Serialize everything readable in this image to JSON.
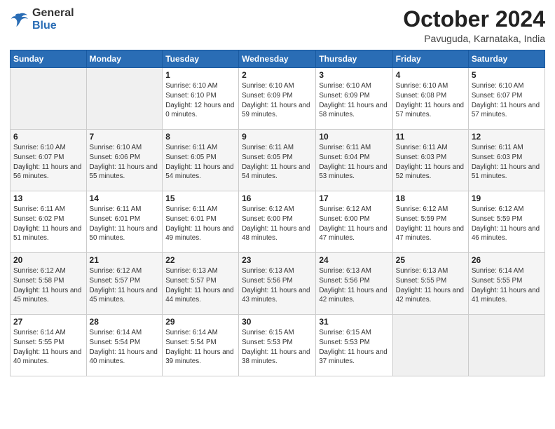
{
  "logo": {
    "line1": "General",
    "line2": "Blue"
  },
  "header": {
    "month": "October 2024",
    "location": "Pavuguda, Karnataka, India"
  },
  "weekdays": [
    "Sunday",
    "Monday",
    "Tuesday",
    "Wednesday",
    "Thursday",
    "Friday",
    "Saturday"
  ],
  "weeks": [
    [
      {
        "day": "",
        "info": ""
      },
      {
        "day": "",
        "info": ""
      },
      {
        "day": "1",
        "info": "Sunrise: 6:10 AM\nSunset: 6:10 PM\nDaylight: 12 hours\nand 0 minutes."
      },
      {
        "day": "2",
        "info": "Sunrise: 6:10 AM\nSunset: 6:09 PM\nDaylight: 11 hours\nand 59 minutes."
      },
      {
        "day": "3",
        "info": "Sunrise: 6:10 AM\nSunset: 6:09 PM\nDaylight: 11 hours\nand 58 minutes."
      },
      {
        "day": "4",
        "info": "Sunrise: 6:10 AM\nSunset: 6:08 PM\nDaylight: 11 hours\nand 57 minutes."
      },
      {
        "day": "5",
        "info": "Sunrise: 6:10 AM\nSunset: 6:07 PM\nDaylight: 11 hours\nand 57 minutes."
      }
    ],
    [
      {
        "day": "6",
        "info": "Sunrise: 6:10 AM\nSunset: 6:07 PM\nDaylight: 11 hours\nand 56 minutes."
      },
      {
        "day": "7",
        "info": "Sunrise: 6:10 AM\nSunset: 6:06 PM\nDaylight: 11 hours\nand 55 minutes."
      },
      {
        "day": "8",
        "info": "Sunrise: 6:11 AM\nSunset: 6:05 PM\nDaylight: 11 hours\nand 54 minutes."
      },
      {
        "day": "9",
        "info": "Sunrise: 6:11 AM\nSunset: 6:05 PM\nDaylight: 11 hours\nand 54 minutes."
      },
      {
        "day": "10",
        "info": "Sunrise: 6:11 AM\nSunset: 6:04 PM\nDaylight: 11 hours\nand 53 minutes."
      },
      {
        "day": "11",
        "info": "Sunrise: 6:11 AM\nSunset: 6:03 PM\nDaylight: 11 hours\nand 52 minutes."
      },
      {
        "day": "12",
        "info": "Sunrise: 6:11 AM\nSunset: 6:03 PM\nDaylight: 11 hours\nand 51 minutes."
      }
    ],
    [
      {
        "day": "13",
        "info": "Sunrise: 6:11 AM\nSunset: 6:02 PM\nDaylight: 11 hours\nand 51 minutes."
      },
      {
        "day": "14",
        "info": "Sunrise: 6:11 AM\nSunset: 6:01 PM\nDaylight: 11 hours\nand 50 minutes."
      },
      {
        "day": "15",
        "info": "Sunrise: 6:11 AM\nSunset: 6:01 PM\nDaylight: 11 hours\nand 49 minutes."
      },
      {
        "day": "16",
        "info": "Sunrise: 6:12 AM\nSunset: 6:00 PM\nDaylight: 11 hours\nand 48 minutes."
      },
      {
        "day": "17",
        "info": "Sunrise: 6:12 AM\nSunset: 6:00 PM\nDaylight: 11 hours\nand 47 minutes."
      },
      {
        "day": "18",
        "info": "Sunrise: 6:12 AM\nSunset: 5:59 PM\nDaylight: 11 hours\nand 47 minutes."
      },
      {
        "day": "19",
        "info": "Sunrise: 6:12 AM\nSunset: 5:59 PM\nDaylight: 11 hours\nand 46 minutes."
      }
    ],
    [
      {
        "day": "20",
        "info": "Sunrise: 6:12 AM\nSunset: 5:58 PM\nDaylight: 11 hours\nand 45 minutes."
      },
      {
        "day": "21",
        "info": "Sunrise: 6:12 AM\nSunset: 5:57 PM\nDaylight: 11 hours\nand 45 minutes."
      },
      {
        "day": "22",
        "info": "Sunrise: 6:13 AM\nSunset: 5:57 PM\nDaylight: 11 hours\nand 44 minutes."
      },
      {
        "day": "23",
        "info": "Sunrise: 6:13 AM\nSunset: 5:56 PM\nDaylight: 11 hours\nand 43 minutes."
      },
      {
        "day": "24",
        "info": "Sunrise: 6:13 AM\nSunset: 5:56 PM\nDaylight: 11 hours\nand 42 minutes."
      },
      {
        "day": "25",
        "info": "Sunrise: 6:13 AM\nSunset: 5:55 PM\nDaylight: 11 hours\nand 42 minutes."
      },
      {
        "day": "26",
        "info": "Sunrise: 6:14 AM\nSunset: 5:55 PM\nDaylight: 11 hours\nand 41 minutes."
      }
    ],
    [
      {
        "day": "27",
        "info": "Sunrise: 6:14 AM\nSunset: 5:55 PM\nDaylight: 11 hours\nand 40 minutes."
      },
      {
        "day": "28",
        "info": "Sunrise: 6:14 AM\nSunset: 5:54 PM\nDaylight: 11 hours\nand 40 minutes."
      },
      {
        "day": "29",
        "info": "Sunrise: 6:14 AM\nSunset: 5:54 PM\nDaylight: 11 hours\nand 39 minutes."
      },
      {
        "day": "30",
        "info": "Sunrise: 6:15 AM\nSunset: 5:53 PM\nDaylight: 11 hours\nand 38 minutes."
      },
      {
        "day": "31",
        "info": "Sunrise: 6:15 AM\nSunset: 5:53 PM\nDaylight: 11 hours\nand 37 minutes."
      },
      {
        "day": "",
        "info": ""
      },
      {
        "day": "",
        "info": ""
      }
    ]
  ]
}
